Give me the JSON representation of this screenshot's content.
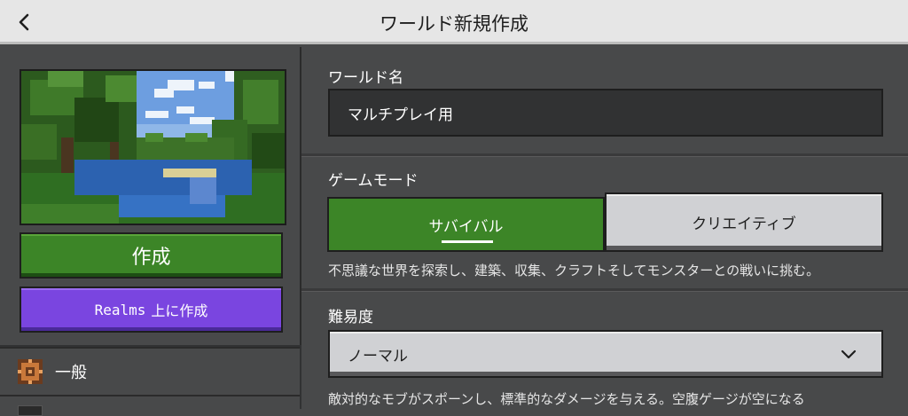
{
  "header": {
    "title": "ワールド新規作成"
  },
  "left": {
    "create_label": "作成",
    "realms_prefix": "Realms",
    "realms_suffix": "上に作成",
    "general_label": "一般"
  },
  "world_name": {
    "label": "ワールド名",
    "value": "マルチプレイ用"
  },
  "game_mode": {
    "label": "ゲームモード",
    "options": [
      "サバイバル",
      "クリエイティブ"
    ],
    "selected": "サバイバル",
    "description": "不思議な世界を探索し、建築、収集、クラフトそしてモンスターとの戦いに挑む。"
  },
  "difficulty": {
    "label": "難易度",
    "value": "ノーマル",
    "description": "敵対的なモブがスポーンし、標準的なダメージを与える。空腹ゲージが空になる"
  },
  "colors": {
    "header_bg": "#e6e6e6",
    "panel_bg": "#48494a",
    "green": "#3c8527",
    "purple": "#7a45e0",
    "light_button": "#d0d1d4"
  }
}
